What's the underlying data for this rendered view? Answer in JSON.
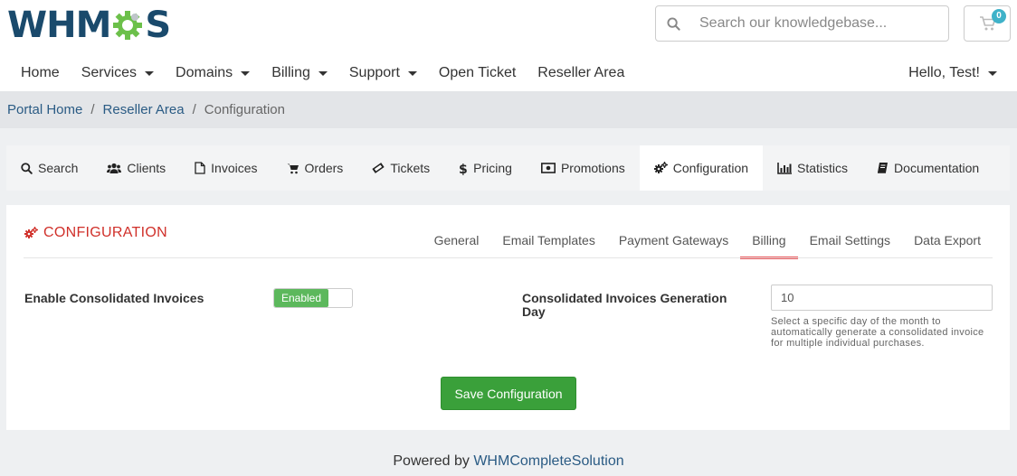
{
  "brand": {
    "prefix": "WHM",
    "suffix": "S",
    "accent": "#6cc04a",
    "navy": "#1a4a6c"
  },
  "search": {
    "placeholder": "Search our knowledgebase..."
  },
  "cart": {
    "count": "0"
  },
  "nav": {
    "items": [
      {
        "label": "Home",
        "dropdown": false
      },
      {
        "label": "Services",
        "dropdown": true
      },
      {
        "label": "Domains",
        "dropdown": true
      },
      {
        "label": "Billing",
        "dropdown": true
      },
      {
        "label": "Support",
        "dropdown": true
      },
      {
        "label": "Open Ticket",
        "dropdown": false
      },
      {
        "label": "Reseller Area",
        "dropdown": false
      }
    ],
    "user": "Hello, Test!"
  },
  "breadcrumb": {
    "home": "Portal Home",
    "section": "Reseller Area",
    "current": "Configuration"
  },
  "module_tabs": [
    {
      "label": "Search",
      "icon": "search-icon"
    },
    {
      "label": "Clients",
      "icon": "users-icon"
    },
    {
      "label": "Invoices",
      "icon": "file-icon"
    },
    {
      "label": "Orders",
      "icon": "cart-icon"
    },
    {
      "label": "Tickets",
      "icon": "ticket-icon"
    },
    {
      "label": "Pricing",
      "icon": "dollar-icon"
    },
    {
      "label": "Promotions",
      "icon": "money-icon"
    },
    {
      "label": "Configuration",
      "icon": "cogs-icon"
    },
    {
      "label": "Statistics",
      "icon": "bar-chart-icon"
    },
    {
      "label": "Documentation",
      "icon": "book-icon"
    }
  ],
  "module_tabs_active": "Configuration",
  "panel": {
    "title": "CONFIGURATION",
    "tabs": [
      "General",
      "Email Templates",
      "Payment Gateways",
      "Billing",
      "Email Settings",
      "Data Export"
    ],
    "active_tab": "Billing"
  },
  "form": {
    "consolidated_label": "Enable Consolidated Invoices",
    "consolidated_state": "Enabled",
    "gen_day_label": "Consolidated Invoices Generation Day",
    "gen_day_value": "10",
    "gen_day_help": "Select a specific day of the month to automatically generate a consolidated invoice for multiple individual purchases.",
    "save_label": "Save Configuration"
  },
  "footer": {
    "prefix": "Powered by",
    "link": "WHMCompleteSolution"
  },
  "colors": {
    "title_red": "#d0302a",
    "tab_underline": "#e9565a",
    "save_green": "#3aa03a",
    "toggle_green": "#5cb85c",
    "link_blue": "#2a5b84"
  }
}
